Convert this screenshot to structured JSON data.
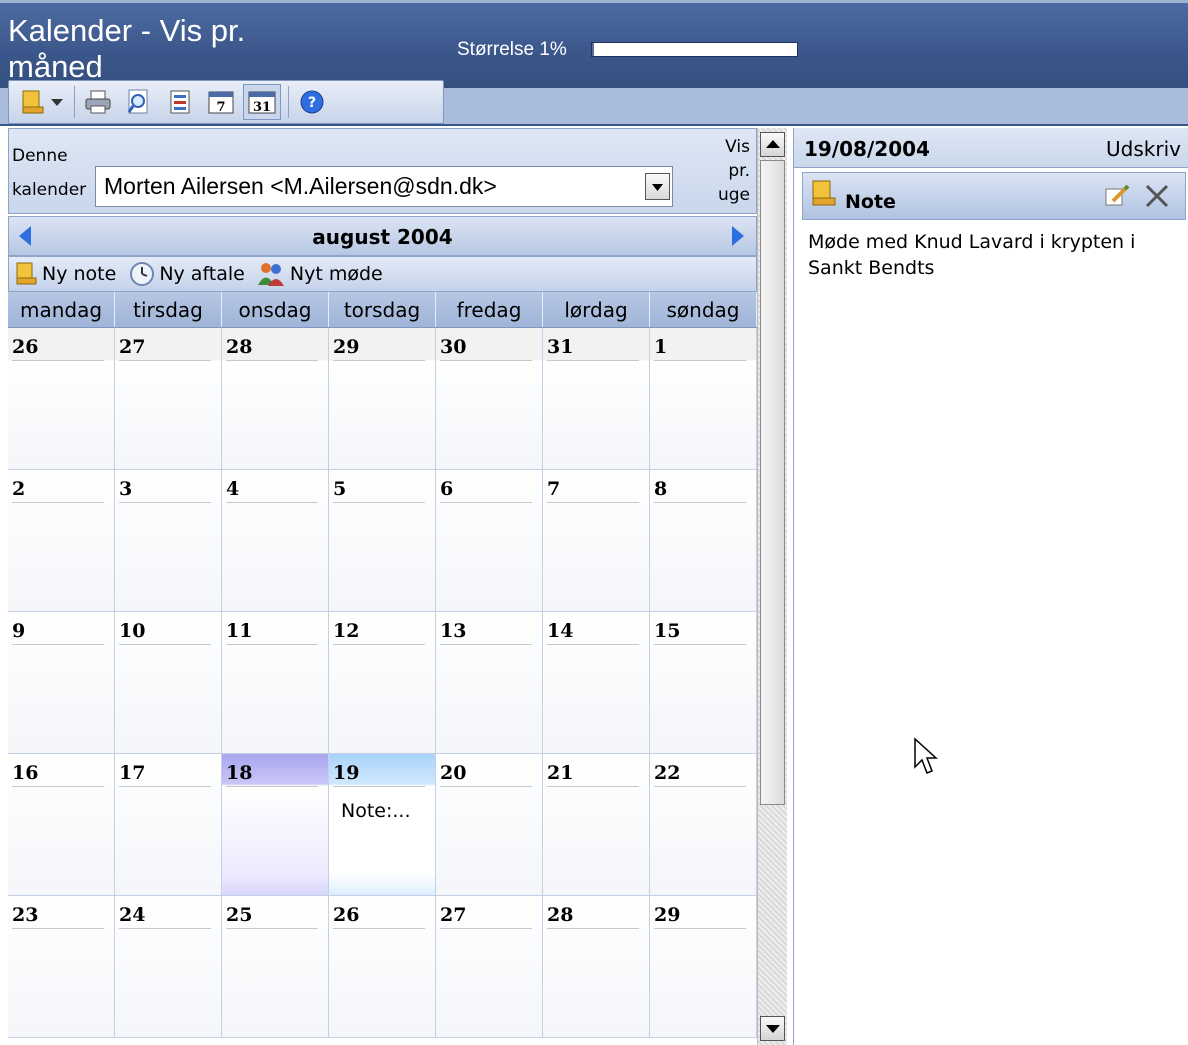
{
  "header": {
    "title": "Kalender - Vis pr. måned",
    "size_label": "Størrelse 1%",
    "size_percent": 1
  },
  "toolbar": {
    "buttons": [
      "new-note-icon",
      "dropdown-arrow-icon",
      "print-icon",
      "preview-icon",
      "export-icon",
      "week-view-icon",
      "month-view-icon",
      "help-icon"
    ]
  },
  "owner": {
    "label": "Denne kalender tilhører",
    "value": "Morten Ailersen <M.Ailersen@sdn.dk>",
    "view_link": "Vis pr. uge"
  },
  "month": {
    "title": "august 2004"
  },
  "actions": {
    "new_note": "Ny note",
    "new_appointment": "Ny aftale",
    "new_meeting": "Nyt møde"
  },
  "calendar": {
    "weekdays": [
      "mandag",
      "tirsdag",
      "onsdag",
      "torsdag",
      "fredag",
      "lørdag",
      "søndag"
    ],
    "weeks": [
      [
        "26",
        "27",
        "28",
        "29",
        "30",
        "31",
        "1"
      ],
      [
        "2",
        "3",
        "4",
        "5",
        "6",
        "7",
        "8"
      ],
      [
        "9",
        "10",
        "11",
        "12",
        "13",
        "14",
        "15"
      ],
      [
        "16",
        "17",
        "18",
        "19",
        "20",
        "21",
        "22"
      ],
      [
        "23",
        "24",
        "25",
        "26",
        "27",
        "28",
        "29"
      ]
    ],
    "today": "18",
    "selected": "19",
    "selected_note": "Note:..."
  },
  "detail": {
    "date": "19/08/2004",
    "print_label": "Udskriv",
    "note_title": "Note",
    "note_text": "Møde med Knud Lavard i krypten i Sankt Bendts"
  },
  "colors": {
    "header": "#3b568a",
    "accent": "#2f6ee0",
    "today": "#a9a5f0",
    "selected": "#a9d3fb"
  }
}
